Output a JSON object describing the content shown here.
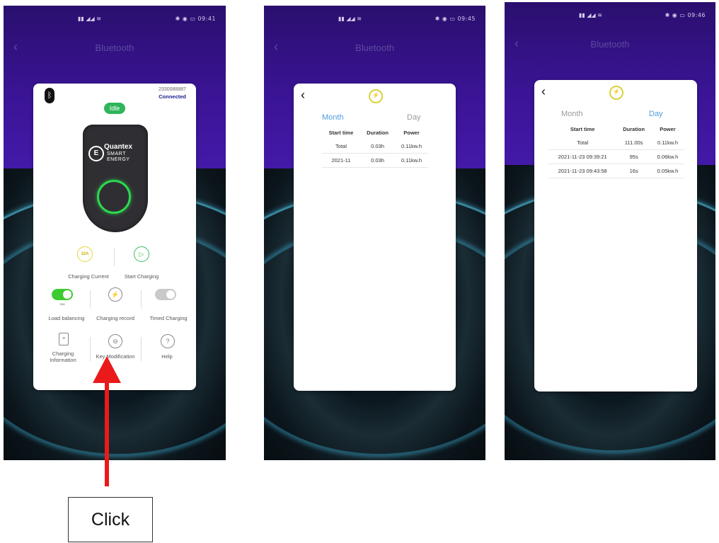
{
  "screens": [
    {
      "status_time": "09:41",
      "title": "Bluetooth",
      "device": {
        "serial": "2330088887",
        "connection": "Connected",
        "state": "Idle",
        "brand": "Quantex",
        "brand_sub_1": "SMART",
        "brand_sub_2": "ENERGY",
        "current_badge": "32A"
      },
      "actions": [
        {
          "label": "Charging Current"
        },
        {
          "label": "Start Charging"
        }
      ],
      "toggles": [
        {
          "label": "Load balancing",
          "on": true,
          "sub": "32A"
        },
        {
          "label": "Charging record"
        },
        {
          "label": "Timed Charging",
          "on": false
        }
      ],
      "menu": [
        {
          "label": "Charging Information"
        },
        {
          "label": "Key Modification"
        },
        {
          "label": "Help"
        }
      ]
    },
    {
      "status_time": "09:45",
      "title": "Bluetooth",
      "tabs": [
        {
          "label": "Month",
          "active": true
        },
        {
          "label": "Day",
          "active": false
        }
      ],
      "columns": [
        "Start time",
        "Duration",
        "Power"
      ],
      "rows": [
        [
          "Total",
          "0.03h",
          "0.11kw.h"
        ],
        [
          "2021-11",
          "0.03h",
          "0.11kw.h"
        ]
      ]
    },
    {
      "status_time": "09:46",
      "title": "Bluetooth",
      "tabs": [
        {
          "label": "Month",
          "active": false
        },
        {
          "label": "Day",
          "active": true
        }
      ],
      "columns": [
        "Start time",
        "Duration",
        "Power"
      ],
      "rows": [
        [
          "Total",
          "111.00s",
          "0.11kw.h"
        ],
        [
          "2021-11-23 09:39:21",
          "95s",
          "0.06kw.h"
        ],
        [
          "2021-11-23 09:43:58",
          "16s",
          "0.05kw.h"
        ]
      ]
    }
  ],
  "annotation": {
    "label": "Click",
    "color": "#ea1a1a"
  }
}
